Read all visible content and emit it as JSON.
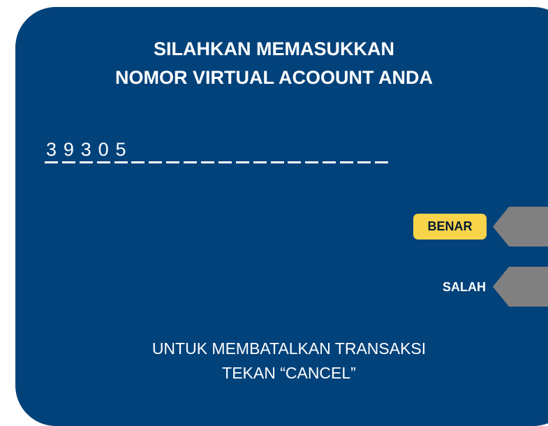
{
  "screen": {
    "title_line1": "SILAHKAN MEMASUKKAN",
    "title_line2": "NOMOR VIRTUAL ACOOUNT ANDA",
    "va_digits": [
      "3",
      "9",
      "3",
      "0",
      "5",
      "",
      "",
      "",
      "",
      "",
      "",
      "",
      "",
      "",
      "",
      "",
      "",
      "",
      "",
      ""
    ],
    "buttons": {
      "benar": "BENAR",
      "salah": "SALAH"
    },
    "footer_line1": "UNTUK MEMBATALKAN TRANSAKSI",
    "footer_line2": "TEKAN “CANCEL”"
  },
  "colors": {
    "screen_bg": "#02427a",
    "highlight": "#f8d44a",
    "side_button": "#808080",
    "text": "#ffffff"
  }
}
